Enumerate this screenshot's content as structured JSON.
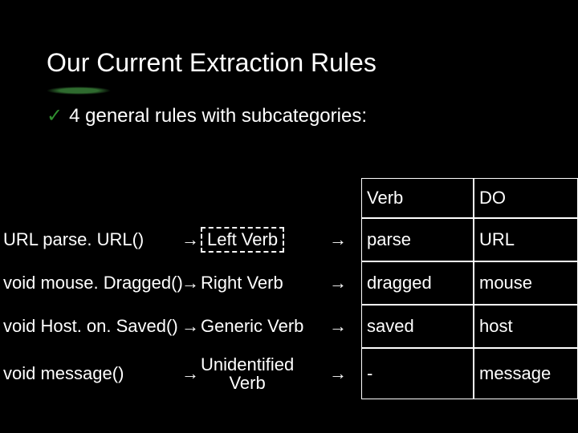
{
  "title": "Our Current Extraction Rules",
  "bullet": "4 general rules with subcategories:",
  "headers": {
    "verb": "Verb",
    "do": "DO"
  },
  "rows": [
    {
      "code": "URL parse. URL()",
      "category": "Left Verb",
      "verb": "parse",
      "do": "URL",
      "dashed": true,
      "multi": false
    },
    {
      "code": "void mouse. Dragged()",
      "category": "Right Verb",
      "verb": "dragged",
      "do": "mouse",
      "dashed": false,
      "multi": false
    },
    {
      "code": "void Host. on. Saved()",
      "category": "Generic Verb",
      "verb": "saved",
      "do": "host",
      "dashed": false,
      "multi": false
    },
    {
      "code": "void message()",
      "category": "Unidentified Verb",
      "verb": "-",
      "do": "message",
      "dashed": false,
      "multi": true
    }
  ]
}
